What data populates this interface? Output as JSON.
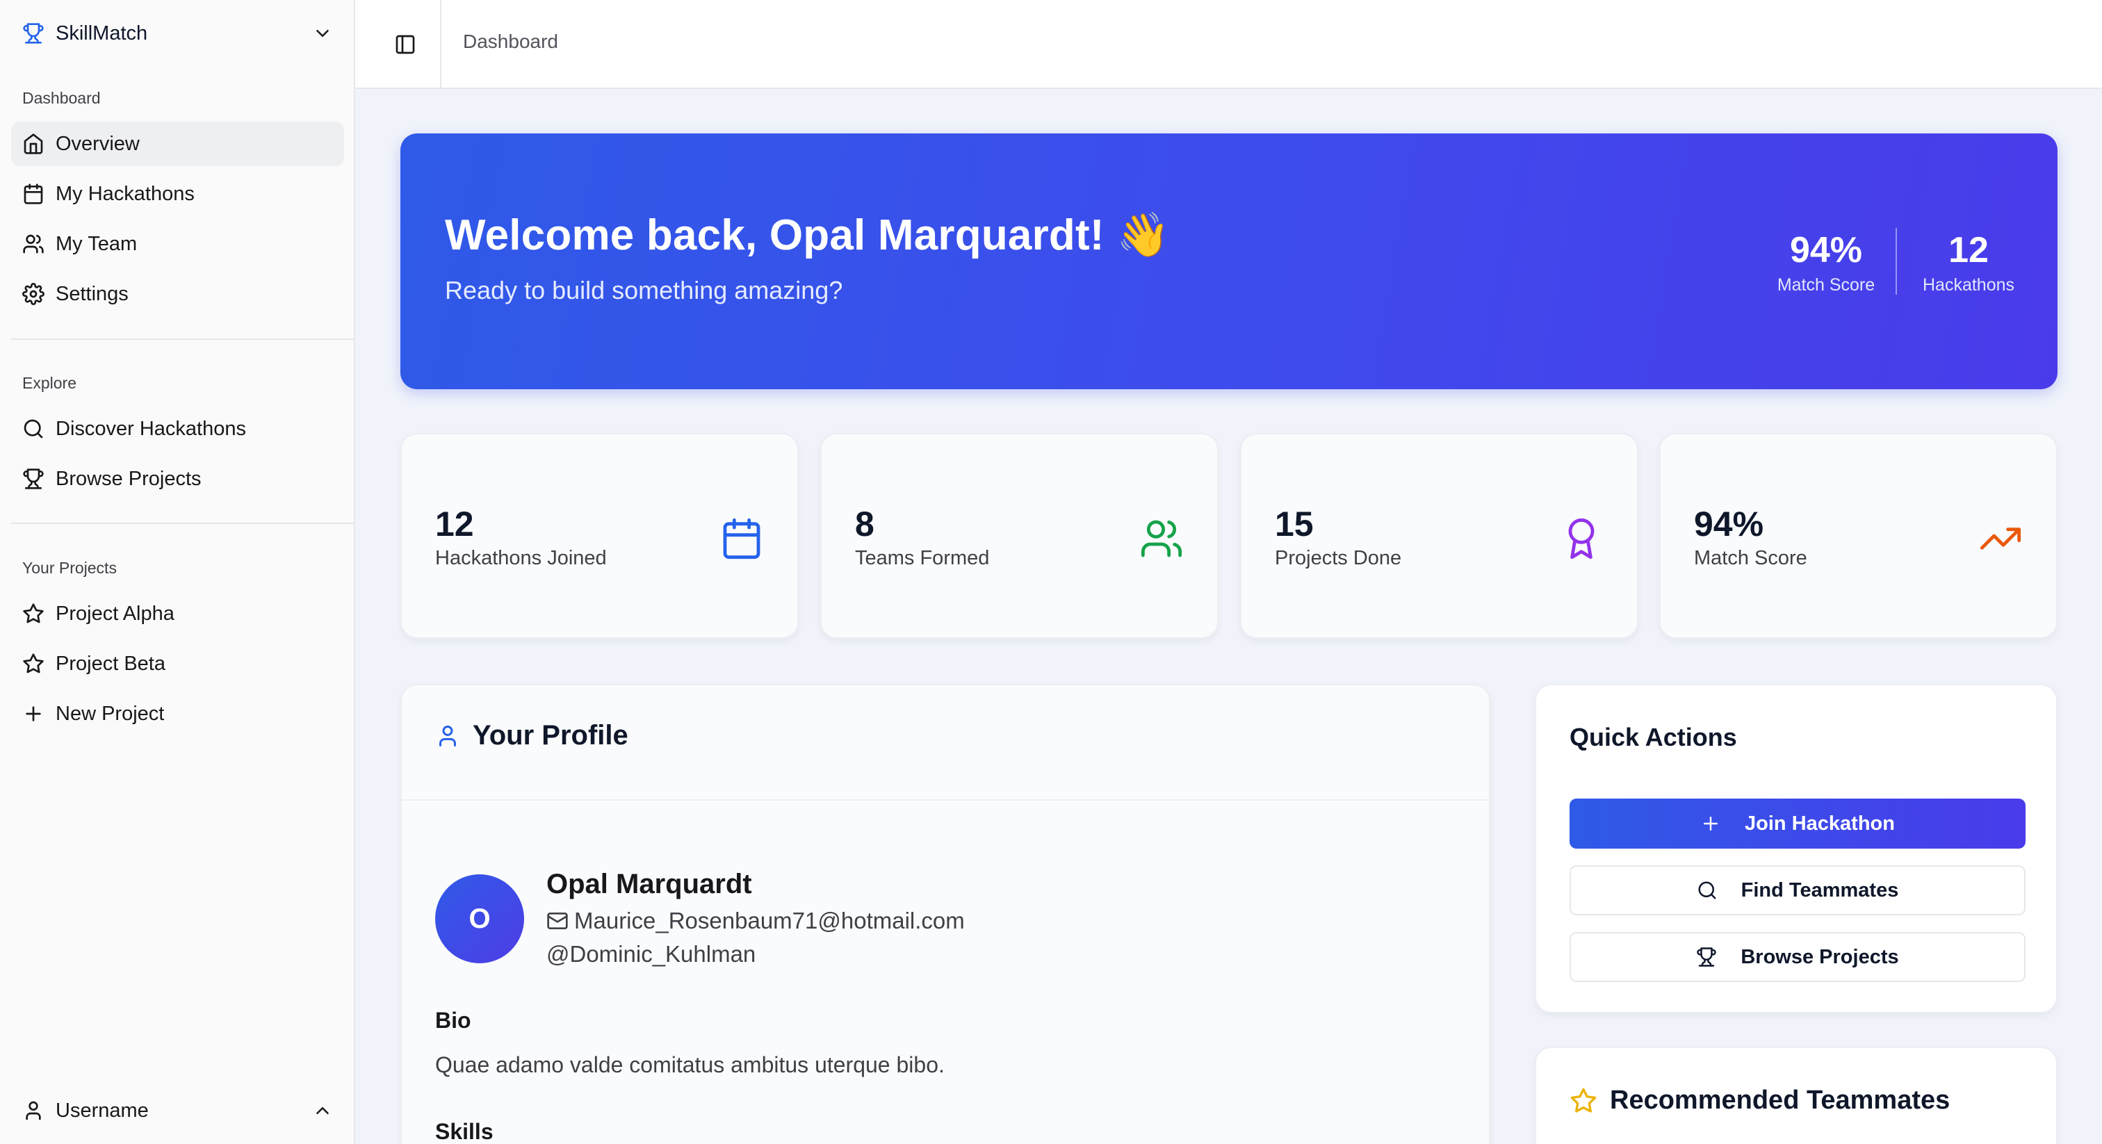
{
  "sidebar": {
    "brand": "SkillMatch",
    "groups": {
      "dashboard": "Dashboard",
      "explore": "Explore",
      "projects": "Your Projects"
    },
    "dashboard_items": [
      "Overview",
      "My Hackathons",
      "My Team",
      "Settings"
    ],
    "explore_items": [
      "Discover Hackathons",
      "Browse Projects"
    ],
    "project_items": [
      "Project Alpha",
      "Project Beta",
      "New Project"
    ],
    "user": "Username"
  },
  "header": {
    "breadcrumb": "Dashboard"
  },
  "banner": {
    "title": "Welcome back, Opal Marquardt! 👋",
    "subtitle": "Ready to build something amazing?",
    "stats": [
      {
        "value": "94%",
        "label": "Match Score"
      },
      {
        "value": "12",
        "label": "Hackathons"
      }
    ]
  },
  "stats": [
    {
      "value": "12",
      "label": "Hackathons Joined",
      "icon": "calendar-icon",
      "color": "#2563eb"
    },
    {
      "value": "8",
      "label": "Teams Formed",
      "icon": "users-icon",
      "color": "#16a34a"
    },
    {
      "value": "15",
      "label": "Projects Done",
      "icon": "award-icon",
      "color": "#9333ea"
    },
    {
      "value": "94%",
      "label": "Match Score",
      "icon": "trending-up-icon",
      "color": "#ea580c"
    }
  ],
  "profile": {
    "title": "Your Profile",
    "avatar_initial": "O",
    "name": "Opal Marquardt",
    "email": "Maurice_Rosenbaum71@hotmail.com",
    "handle": "@Dominic_Kuhlman",
    "bio_label": "Bio",
    "bio": "Quae adamo valde comitatus ambitus uterque bibo.",
    "skills_label": "Skills"
  },
  "quick_actions": {
    "title": "Quick Actions",
    "buttons": [
      "Join Hackathon",
      "Find Teammates",
      "Browse Projects"
    ]
  },
  "recommended": {
    "title": "Recommended Teammates"
  },
  "colors": {
    "accent": "#3d4cec",
    "accent_start": "#2f5ae8",
    "accent_end": "#4a3bea",
    "star": "#eab308"
  }
}
